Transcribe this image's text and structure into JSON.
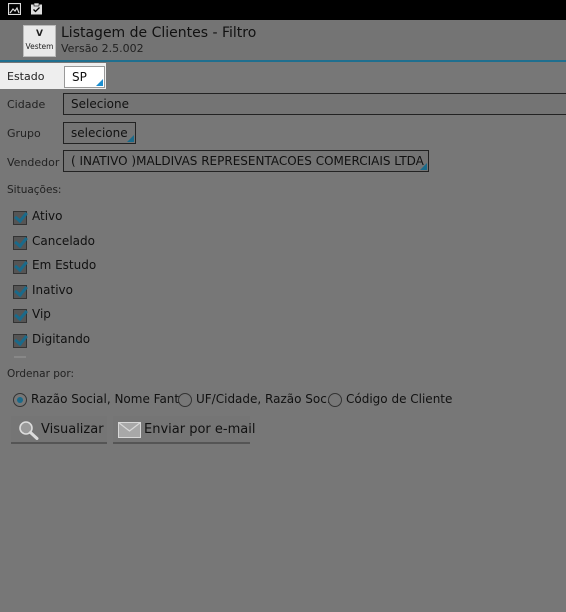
{
  "status_bar": {
    "icons": [
      "image-icon",
      "clipboard-check-icon"
    ]
  },
  "app": {
    "logo_text": "Vestem",
    "logo_mark": "V",
    "title": "Listagem de Clientes - Filtro",
    "version": "Versão 2.5.002"
  },
  "filters": {
    "estado": {
      "label": "Estado",
      "value": "SP"
    },
    "cidade": {
      "label": "Cidade",
      "value": "Selecione"
    },
    "grupo": {
      "label": "Grupo",
      "value": "selecione"
    },
    "vendedor": {
      "label": "Vendedor",
      "value": "( INATIVO )MALDIVAS REPRESENTACOES COMERCIAIS LTDA"
    }
  },
  "situacoes": {
    "label": "Situações:",
    "items": [
      {
        "label": "Ativo",
        "checked": true
      },
      {
        "label": "Cancelado",
        "checked": true
      },
      {
        "label": "Em Estudo",
        "checked": true
      },
      {
        "label": "Inativo",
        "checked": true
      },
      {
        "label": "Vip",
        "checked": true
      },
      {
        "label": "Digitando",
        "checked": true
      }
    ]
  },
  "ordenar": {
    "label": "Ordenar por:",
    "options": [
      {
        "label": "Razão Social, Nome Fant.",
        "selected": true
      },
      {
        "label": "UF/Cidade, Razão Soc.",
        "selected": false
      },
      {
        "label": "Código de Cliente",
        "selected": false
      }
    ]
  },
  "actions": {
    "visualizar": "Visualizar",
    "email": "Enviar por e-mail"
  },
  "colors": {
    "accent": "#1a6a8a",
    "background": "#777777",
    "status_bar": "#000000"
  }
}
